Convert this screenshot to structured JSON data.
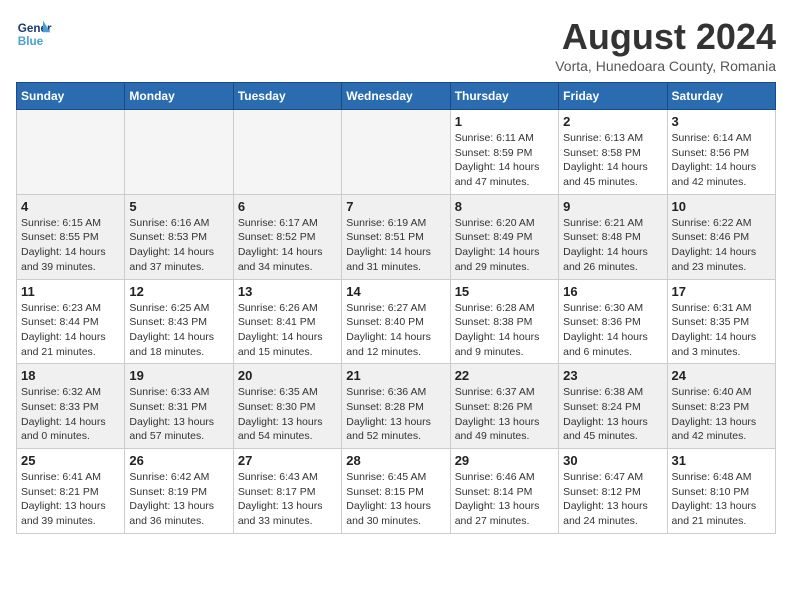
{
  "header": {
    "logo_line1": "General",
    "logo_line2": "Blue",
    "month": "August 2024",
    "location": "Vorta, Hunedoara County, Romania"
  },
  "days_of_week": [
    "Sunday",
    "Monday",
    "Tuesday",
    "Wednesday",
    "Thursday",
    "Friday",
    "Saturday"
  ],
  "weeks": [
    [
      {
        "day": "",
        "info": ""
      },
      {
        "day": "",
        "info": ""
      },
      {
        "day": "",
        "info": ""
      },
      {
        "day": "",
        "info": ""
      },
      {
        "day": "1",
        "info": "Sunrise: 6:11 AM\nSunset: 8:59 PM\nDaylight: 14 hours and 47 minutes."
      },
      {
        "day": "2",
        "info": "Sunrise: 6:13 AM\nSunset: 8:58 PM\nDaylight: 14 hours and 45 minutes."
      },
      {
        "day": "3",
        "info": "Sunrise: 6:14 AM\nSunset: 8:56 PM\nDaylight: 14 hours and 42 minutes."
      }
    ],
    [
      {
        "day": "4",
        "info": "Sunrise: 6:15 AM\nSunset: 8:55 PM\nDaylight: 14 hours and 39 minutes."
      },
      {
        "day": "5",
        "info": "Sunrise: 6:16 AM\nSunset: 8:53 PM\nDaylight: 14 hours and 37 minutes."
      },
      {
        "day": "6",
        "info": "Sunrise: 6:17 AM\nSunset: 8:52 PM\nDaylight: 14 hours and 34 minutes."
      },
      {
        "day": "7",
        "info": "Sunrise: 6:19 AM\nSunset: 8:51 PM\nDaylight: 14 hours and 31 minutes."
      },
      {
        "day": "8",
        "info": "Sunrise: 6:20 AM\nSunset: 8:49 PM\nDaylight: 14 hours and 29 minutes."
      },
      {
        "day": "9",
        "info": "Sunrise: 6:21 AM\nSunset: 8:48 PM\nDaylight: 14 hours and 26 minutes."
      },
      {
        "day": "10",
        "info": "Sunrise: 6:22 AM\nSunset: 8:46 PM\nDaylight: 14 hours and 23 minutes."
      }
    ],
    [
      {
        "day": "11",
        "info": "Sunrise: 6:23 AM\nSunset: 8:44 PM\nDaylight: 14 hours and 21 minutes."
      },
      {
        "day": "12",
        "info": "Sunrise: 6:25 AM\nSunset: 8:43 PM\nDaylight: 14 hours and 18 minutes."
      },
      {
        "day": "13",
        "info": "Sunrise: 6:26 AM\nSunset: 8:41 PM\nDaylight: 14 hours and 15 minutes."
      },
      {
        "day": "14",
        "info": "Sunrise: 6:27 AM\nSunset: 8:40 PM\nDaylight: 14 hours and 12 minutes."
      },
      {
        "day": "15",
        "info": "Sunrise: 6:28 AM\nSunset: 8:38 PM\nDaylight: 14 hours and 9 minutes."
      },
      {
        "day": "16",
        "info": "Sunrise: 6:30 AM\nSunset: 8:36 PM\nDaylight: 14 hours and 6 minutes."
      },
      {
        "day": "17",
        "info": "Sunrise: 6:31 AM\nSunset: 8:35 PM\nDaylight: 14 hours and 3 minutes."
      }
    ],
    [
      {
        "day": "18",
        "info": "Sunrise: 6:32 AM\nSunset: 8:33 PM\nDaylight: 14 hours and 0 minutes."
      },
      {
        "day": "19",
        "info": "Sunrise: 6:33 AM\nSunset: 8:31 PM\nDaylight: 13 hours and 57 minutes."
      },
      {
        "day": "20",
        "info": "Sunrise: 6:35 AM\nSunset: 8:30 PM\nDaylight: 13 hours and 54 minutes."
      },
      {
        "day": "21",
        "info": "Sunrise: 6:36 AM\nSunset: 8:28 PM\nDaylight: 13 hours and 52 minutes."
      },
      {
        "day": "22",
        "info": "Sunrise: 6:37 AM\nSunset: 8:26 PM\nDaylight: 13 hours and 49 minutes."
      },
      {
        "day": "23",
        "info": "Sunrise: 6:38 AM\nSunset: 8:24 PM\nDaylight: 13 hours and 45 minutes."
      },
      {
        "day": "24",
        "info": "Sunrise: 6:40 AM\nSunset: 8:23 PM\nDaylight: 13 hours and 42 minutes."
      }
    ],
    [
      {
        "day": "25",
        "info": "Sunrise: 6:41 AM\nSunset: 8:21 PM\nDaylight: 13 hours and 39 minutes."
      },
      {
        "day": "26",
        "info": "Sunrise: 6:42 AM\nSunset: 8:19 PM\nDaylight: 13 hours and 36 minutes."
      },
      {
        "day": "27",
        "info": "Sunrise: 6:43 AM\nSunset: 8:17 PM\nDaylight: 13 hours and 33 minutes."
      },
      {
        "day": "28",
        "info": "Sunrise: 6:45 AM\nSunset: 8:15 PM\nDaylight: 13 hours and 30 minutes."
      },
      {
        "day": "29",
        "info": "Sunrise: 6:46 AM\nSunset: 8:14 PM\nDaylight: 13 hours and 27 minutes."
      },
      {
        "day": "30",
        "info": "Sunrise: 6:47 AM\nSunset: 8:12 PM\nDaylight: 13 hours and 24 minutes."
      },
      {
        "day": "31",
        "info": "Sunrise: 6:48 AM\nSunset: 8:10 PM\nDaylight: 13 hours and 21 minutes."
      }
    ]
  ]
}
